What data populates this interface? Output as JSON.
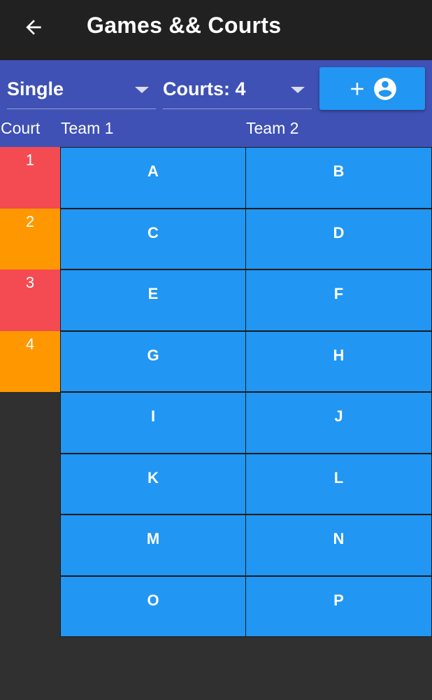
{
  "appbar": {
    "title": "Games && Courts",
    "back_icon": "arrow-back-icon"
  },
  "controls": {
    "mode_value": "Single",
    "courts_value": "Courts: 4",
    "add_player_icons": [
      "plus-icon",
      "account-circle-icon"
    ]
  },
  "headers": {
    "court": "Court",
    "team1": "Team 1",
    "team2": "Team 2"
  },
  "colors": {
    "appbar": "#212121",
    "controls_bg": "#3f51b5",
    "team_cell": "#2196f3",
    "court_red": "#f44b52",
    "court_orange": "#ff9800",
    "background": "#303030"
  },
  "rows": [
    {
      "court": "1",
      "court_color": "#f44b52",
      "team1": "A",
      "team2": "B"
    },
    {
      "court": "2",
      "court_color": "#ff9800",
      "team1": "C",
      "team2": "D"
    },
    {
      "court": "3",
      "court_color": "#f44b52",
      "team1": "E",
      "team2": "F"
    },
    {
      "court": "4",
      "court_color": "#ff9800",
      "team1": "G",
      "team2": "H"
    },
    {
      "court": "",
      "court_color": "",
      "team1": "I",
      "team2": "J"
    },
    {
      "court": "",
      "court_color": "",
      "team1": "K",
      "team2": "L"
    },
    {
      "court": "",
      "court_color": "",
      "team1": "M",
      "team2": "N"
    },
    {
      "court": "",
      "court_color": "",
      "team1": "O",
      "team2": "P"
    }
  ]
}
